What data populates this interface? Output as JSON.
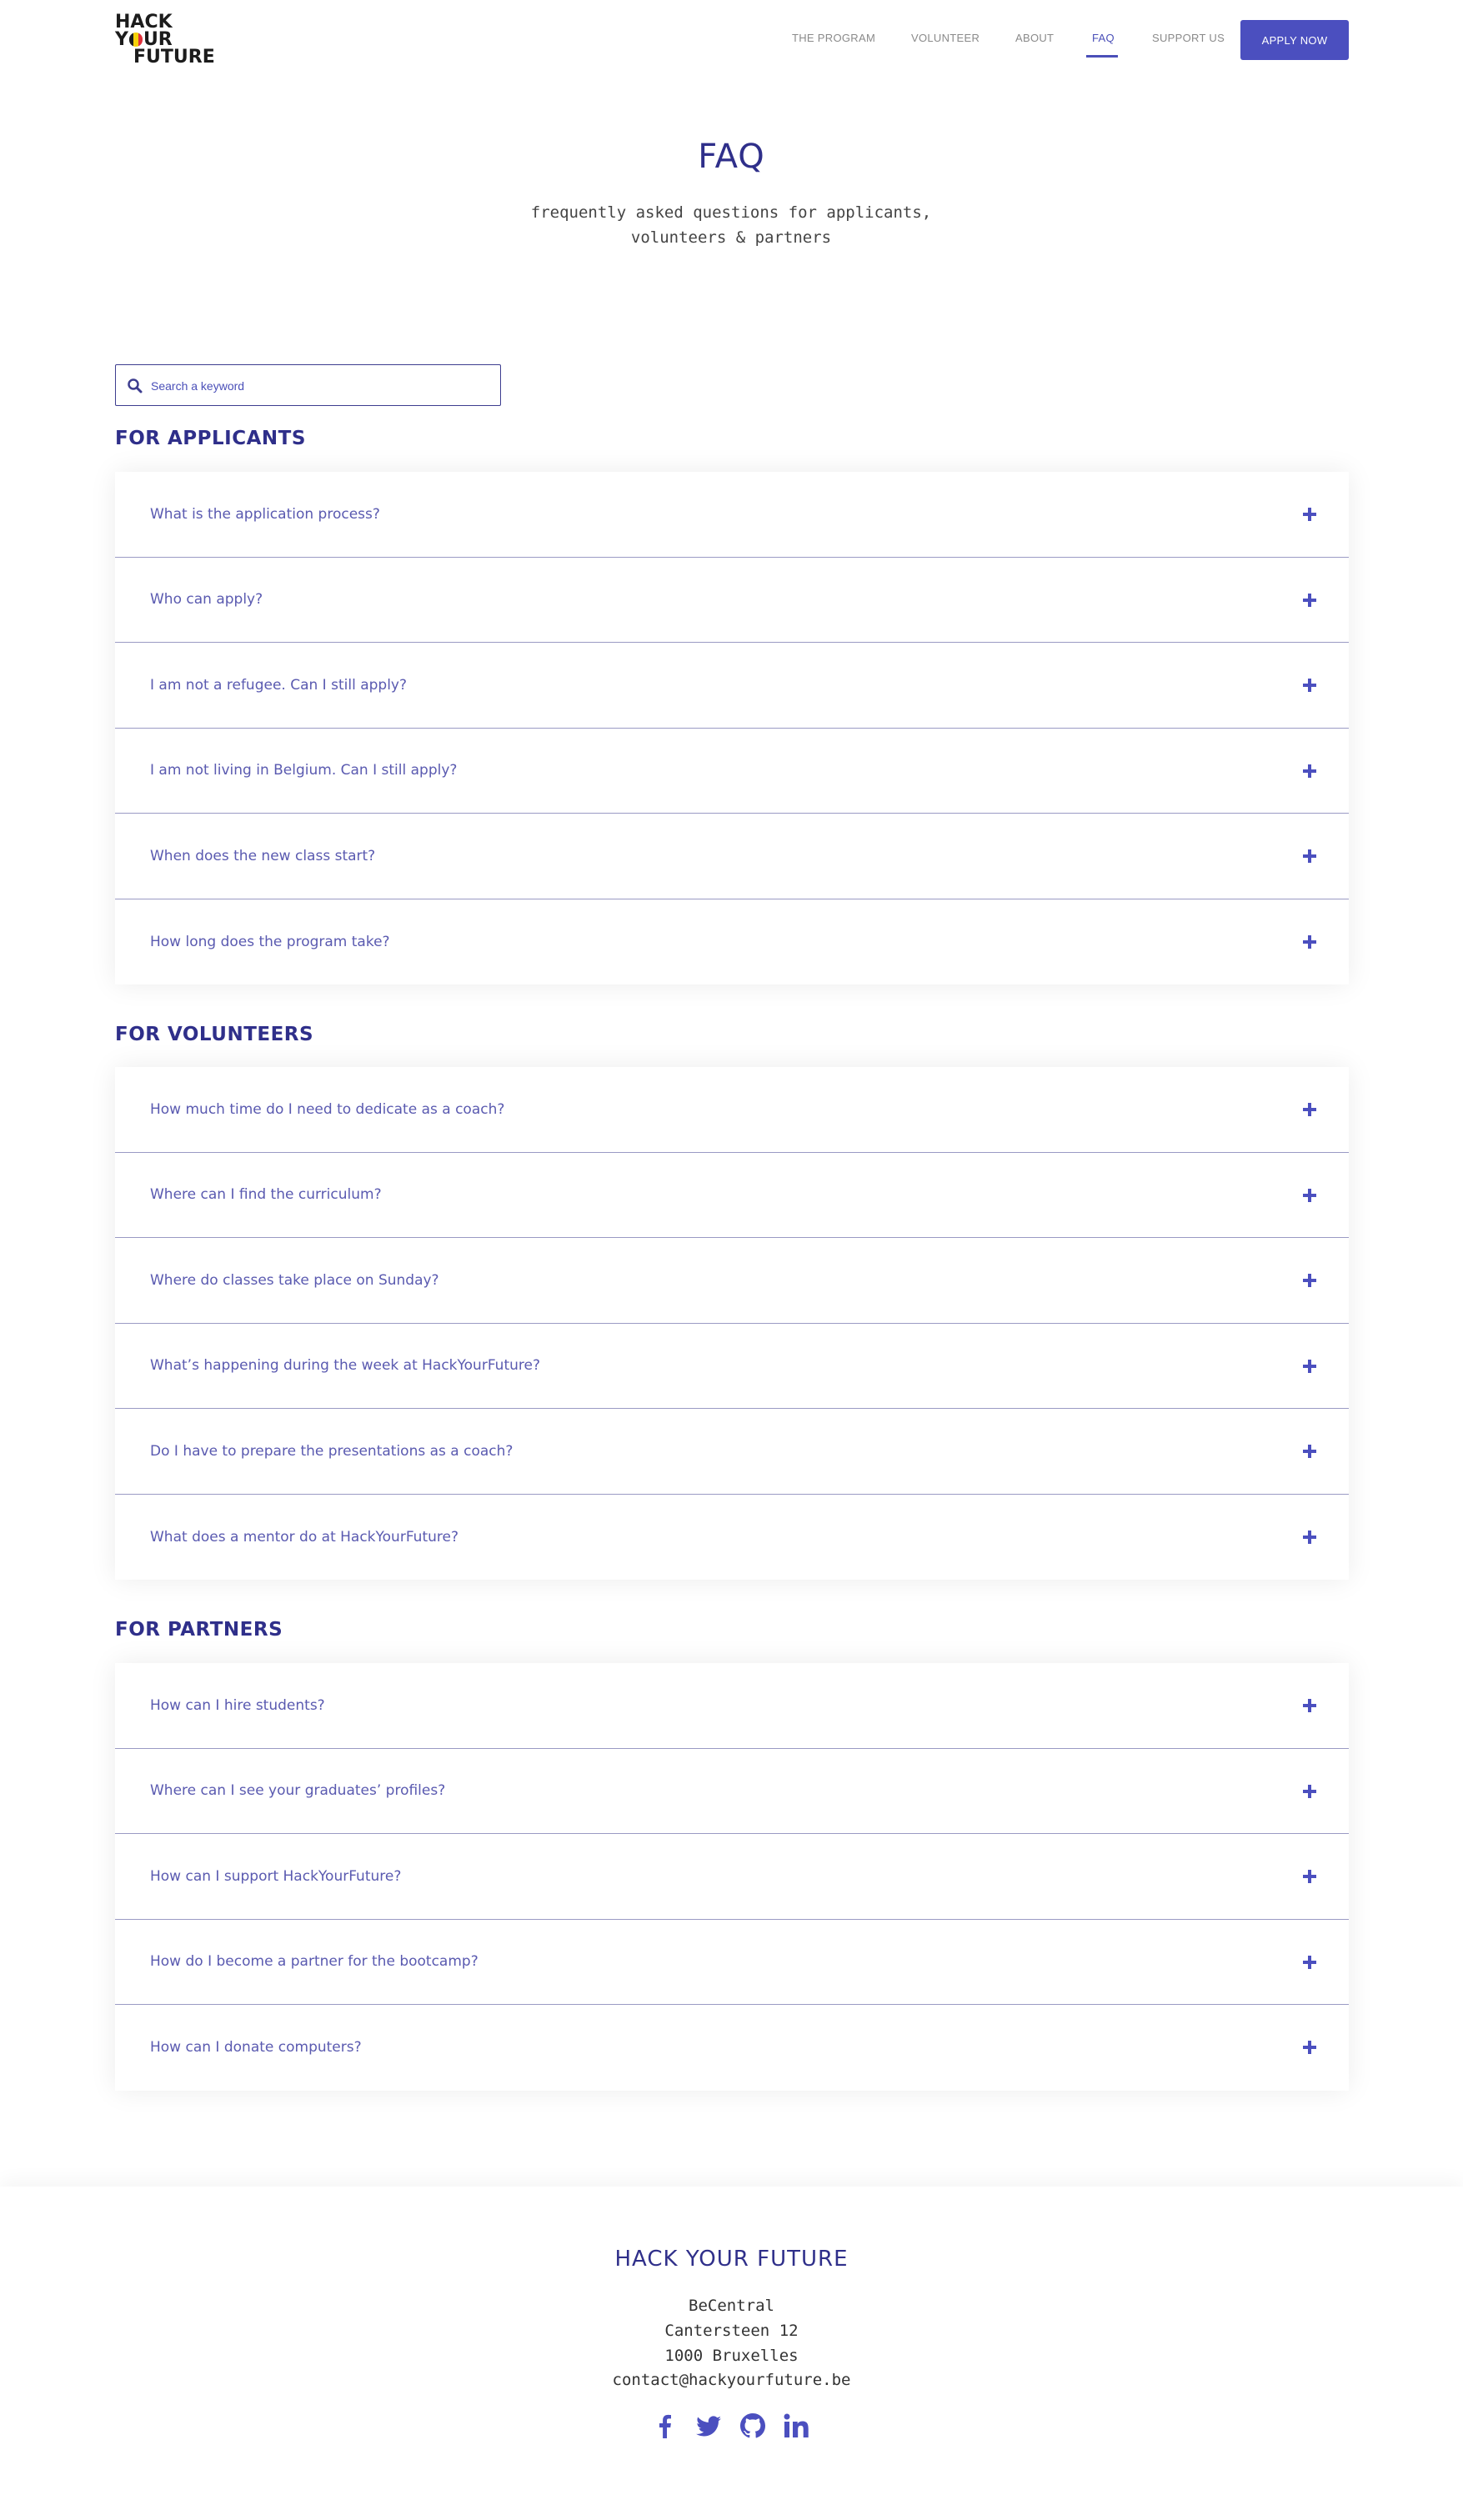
{
  "header": {
    "logo": {
      "line1": "HACK",
      "line2_pre": "Y",
      "line2_post": "UR",
      "line3": "FUTURE",
      "flag_colors": [
        "#1c1c1c",
        "#f5d20a",
        "#e0313c"
      ]
    },
    "nav": [
      {
        "label": "THE PROGRAM"
      },
      {
        "label": "VOLUNTEER"
      },
      {
        "label": "ABOUT"
      },
      {
        "label": "FAQ",
        "active": true
      },
      {
        "label": "SUPPORT US"
      }
    ],
    "apply_label": "APPLY NOW"
  },
  "hero": {
    "title": "FAQ",
    "subtitle_line1": "frequently asked questions for applicants,",
    "subtitle_line2": "volunteers & partners"
  },
  "search": {
    "placeholder": "Search a keyword",
    "value": ""
  },
  "sections": [
    {
      "title": "FOR APPLICANTS",
      "questions": [
        "What is the application process?",
        "Who can apply?",
        "I am not a refugee. Can I still apply?",
        "I am not living in Belgium. Can I still apply?",
        "When does the new class start?",
        "How long does the program take?"
      ]
    },
    {
      "title": "FOR VOLUNTEERS",
      "questions": [
        "How much time do I need to dedicate as a coach?",
        "Where can I find the curriculum?",
        "Where do classes take place on Sunday?",
        "What’s happening during the week at HackYourFuture?",
        "Do I have to prepare the presentations as a coach?",
        "What does a mentor do at HackYourFuture?"
      ]
    },
    {
      "title": "FOR PARTNERS",
      "questions": [
        "How can I hire students?",
        "Where can I see your graduates’ profiles?",
        "How can I support HackYourFuture?",
        "How do I become a partner for the bootcamp?",
        "How can I donate computers?"
      ]
    }
  ],
  "footer": {
    "title": "HACK YOUR FUTURE",
    "address_line1": "BeCentral",
    "address_line2": "Cantersteen 12",
    "address_line3": "1000 Bruxelles",
    "email": "contact@hackyourfuture.be",
    "social_icons": [
      "facebook-icon",
      "twitter-icon",
      "github-icon",
      "linkedin-icon"
    ]
  },
  "colors": {
    "accent": "#4b4fbf",
    "heading": "#2f2f8a",
    "question": "#5a5ab0",
    "divider": "#9a9ac4"
  }
}
